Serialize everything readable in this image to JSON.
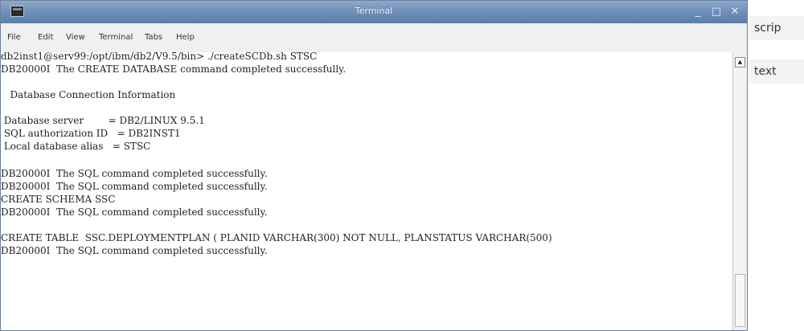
{
  "window": {
    "title": "Terminal",
    "icon": "terminal-icon"
  },
  "controls": {
    "minimize": "_",
    "maximize": "□",
    "close": "✕"
  },
  "menu": [
    "File",
    "Edit",
    "View",
    "Terminal",
    "Tabs",
    "Help"
  ],
  "terminal_lines": [
    "db2inst1@serv99:/opt/ibm/db2/V9.5/bin> ./createSCDb.sh STSC",
    "DB20000I  The CREATE DATABASE command completed successfully.",
    "",
    "   Database Connection Information",
    "",
    " Database server        = DB2/LINUX 9.5.1",
    " SQL authorization ID   = DB2INST1",
    " Local database alias   = STSC",
    "",
    "DB20000I  The SQL command completed successfully.",
    "DB20000I  The SQL command completed successfully.",
    "CREATE SCHEMA SSC",
    "DB20000I  The SQL command completed successfully.",
    "",
    "CREATE TABLE  SSC.DEPLOYMENTPLAN ( PLANID VARCHAR(300) NOT NULL, PLANSTATUS VARCHAR(500)",
    "DB20000I  The SQL command completed successfully."
  ],
  "side_panel": {
    "item1": "scrip",
    "item2": "text"
  }
}
